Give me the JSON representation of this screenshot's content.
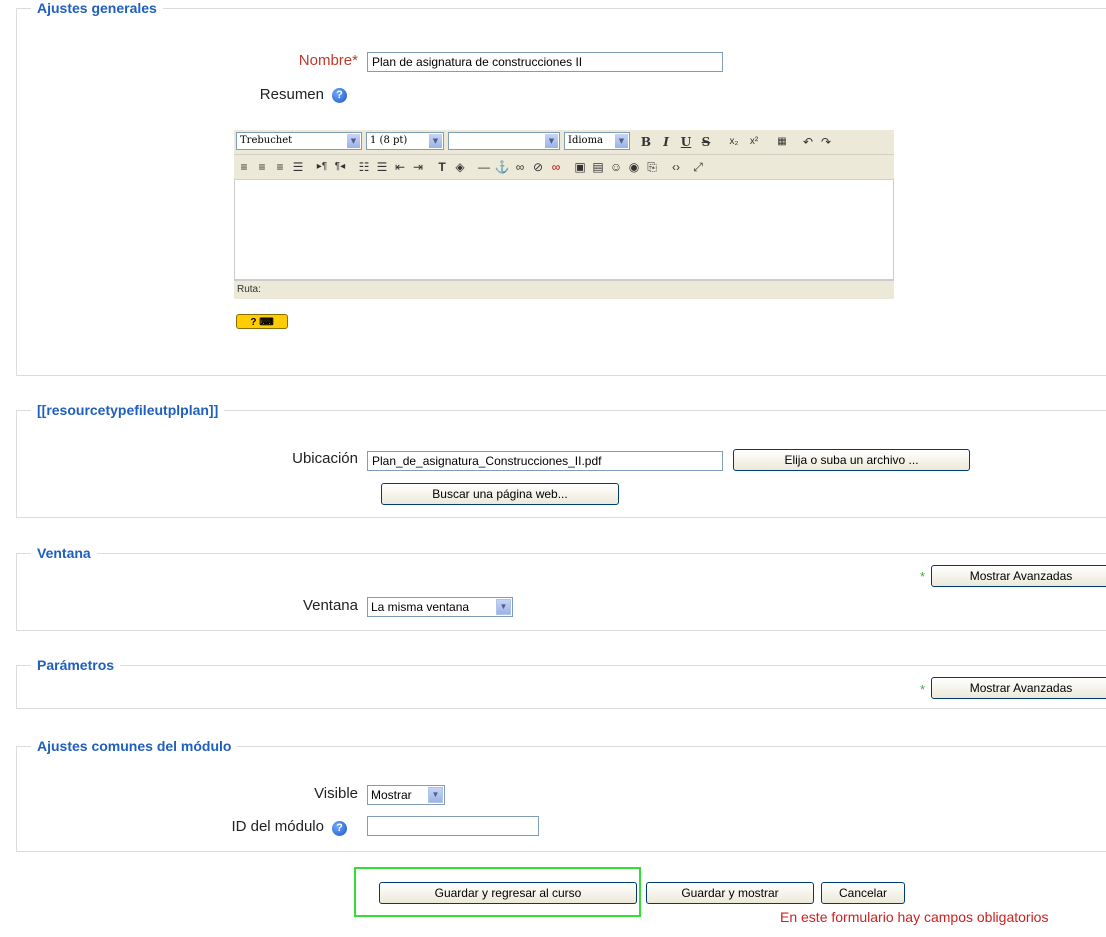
{
  "general": {
    "legend": "Ajustes generales",
    "name_label": "Nombre",
    "name_required": "*",
    "name_value": "Plan de asignatura de construcciones II",
    "summary_label": "Resumen",
    "help_glyph": "?",
    "editor": {
      "font": "Trebuchet",
      "size": "1 (8 pt)",
      "style": "",
      "language": "Idioma",
      "path_label": "Ruta:",
      "keyboard_icon": "keyboard-shortcuts-icon"
    }
  },
  "resource": {
    "legend": "[[resourcetypefileutplplan]]",
    "location_label": "Ubicación",
    "location_value": "Plan_de_asignatura_Construcciones_II.pdf",
    "choose_file_button": "Elija o suba un archivo ...",
    "search_web_button": "Buscar una página web..."
  },
  "window": {
    "legend": "Ventana",
    "show_advanced": "Mostrar Avanzadas",
    "window_label": "Ventana",
    "window_value": "La misma ventana"
  },
  "params": {
    "legend": "Parámetros",
    "show_advanced": "Mostrar Avanzadas"
  },
  "common": {
    "legend": "Ajustes comunes del módulo",
    "visible_label": "Visible",
    "visible_value": "Mostrar",
    "idnumber_label": "ID del módulo",
    "idnumber_value": ""
  },
  "actions": {
    "save_return": "Guardar y regresar al curso",
    "save_display": "Guardar y mostrar",
    "cancel": "Cancelar",
    "required_note": "En este formulario hay campos obligatorios"
  },
  "colors": {
    "legend": "#1f5fbf",
    "required": "#cc2222",
    "highlight": "#33dd33"
  }
}
